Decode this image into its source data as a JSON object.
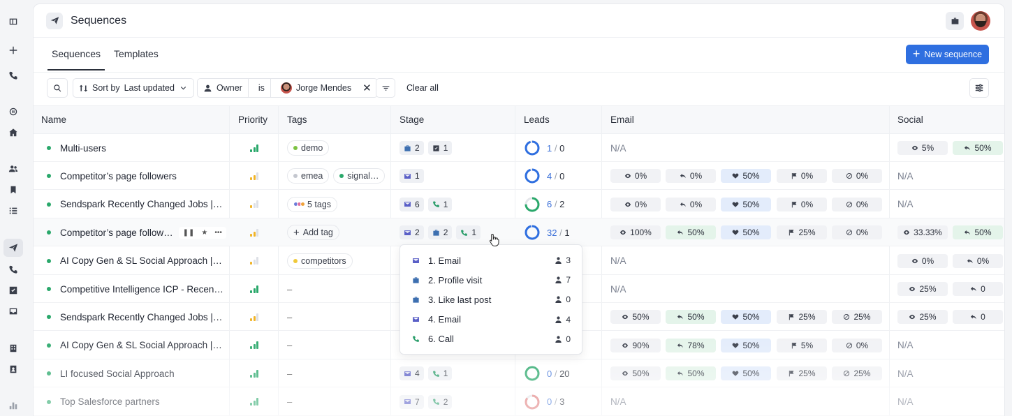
{
  "app": {
    "title": "Sequences"
  },
  "tabs": [
    {
      "label": "Sequences",
      "active": true
    },
    {
      "label": "Templates",
      "active": false
    }
  ],
  "new_button": {
    "label": "New sequence"
  },
  "filters": {
    "sort_prefix": "Sort by",
    "sort_value": "Last updated",
    "owner_label": "Owner",
    "operator": "is",
    "owner_value": "Jorge Mendes",
    "clear_all": "Clear all"
  },
  "columns": {
    "name": "Name",
    "priority": "Priority",
    "tags": "Tags",
    "stage": "Stage",
    "leads": "Leads",
    "email": "Email",
    "social": "Social"
  },
  "colors": {
    "accent": "#2f6fe0",
    "active_dot": "#2aa86b",
    "email_stage": "#5a5fc7",
    "linkedin_stage": "#3d6fb0",
    "call_stage": "#2a9d6a",
    "priority_high": "#2aa86b",
    "priority_mid": "#f0b429"
  },
  "rows": [
    {
      "name": "Multi-users",
      "priority": "high",
      "tags": [
        {
          "label": "demo",
          "color": "#7cc242"
        }
      ],
      "stage": [
        {
          "type": "linkedin",
          "count": "2"
        },
        {
          "type": "task",
          "count": "1"
        }
      ],
      "leads_a": "1",
      "leads_b": "0",
      "ring": 0.95,
      "ring_color": "#2f6fe0",
      "email_na": "N/A",
      "social": [
        "5%",
        "50%"
      ]
    },
    {
      "name": "Competitor’s page followers",
      "priority": "mid",
      "tags": [
        {
          "label": "emea",
          "color": "#c4c7cf"
        },
        {
          "label": "signal…",
          "color": "#2aa86b"
        }
      ],
      "stage": [
        {
          "type": "email",
          "count": "1"
        }
      ],
      "leads_a": "4",
      "leads_b": "0",
      "ring": 0.95,
      "ring_color": "#2f6fe0",
      "email": [
        "0%",
        "0%",
        "50%",
        "0%",
        "0%"
      ],
      "social_na": "N/A"
    },
    {
      "name": "Sendspark Recently Changed Jobs |…",
      "priority": "low",
      "tags": [
        {
          "label": "5 tags",
          "multi": true
        }
      ],
      "stage": [
        {
          "type": "email",
          "count": "6"
        },
        {
          "type": "call",
          "count": "1"
        }
      ],
      "leads_a": "6",
      "leads_b": "2",
      "ring": 0.75,
      "ring_color": "#2aa86b",
      "email": [
        "0%",
        "0%",
        "50%",
        "0%",
        "0%"
      ],
      "social_na": "N/A"
    },
    {
      "name": "Competitor’s page follow…",
      "priority": "mid",
      "hover": true,
      "add_tag": "Add tag",
      "stage": [
        {
          "type": "email",
          "count": "2"
        },
        {
          "type": "linkedin",
          "count": "2"
        },
        {
          "type": "call",
          "count": "1"
        }
      ],
      "leads_a": "32",
      "leads_b": "1",
      "ring": 0.97,
      "ring_color": "#2f6fe0",
      "email": [
        "100%",
        "50%",
        "50%",
        "25%",
        "0%"
      ],
      "social": [
        "33.33%",
        "50%"
      ]
    },
    {
      "name": "AI Copy Gen & SL Social Approach | S…",
      "priority": "low",
      "tags": [
        {
          "label": "competitors",
          "color": "#f0c93a"
        }
      ],
      "email_na": "N/A",
      "social": [
        "0%",
        "0%"
      ]
    },
    {
      "name": "Competitive Intelligence ICP - Recent…",
      "priority": "high",
      "tags_dash": "–",
      "email_na": "N/A",
      "social": [
        "25%",
        "0"
      ]
    },
    {
      "name": "Sendspark Recently Changed Jobs |…",
      "priority": "mid",
      "tags_dash": "–",
      "email": [
        "50%",
        "50%",
        "50%",
        "25%",
        "25%"
      ],
      "social": [
        "25%",
        "0"
      ]
    },
    {
      "name": "AI Copy Gen & SL Social Approach | S…",
      "priority": "high",
      "tags_dash": "–",
      "email": [
        "90%",
        "78%",
        "50%",
        "5%",
        "0%"
      ],
      "social_na": "N/A"
    },
    {
      "name": "LI focused Social Approach",
      "priority": "high",
      "tags_dash": "–",
      "stage": [
        {
          "type": "email",
          "count": "4"
        },
        {
          "type": "call",
          "count": "1"
        }
      ],
      "leads_a": "0",
      "leads_b": "20",
      "ring": 1.0,
      "ring_color": "#2aa86b",
      "email": [
        "50%",
        "50%",
        "50%",
        "25%",
        "25%"
      ],
      "social_na": "N/A"
    },
    {
      "name": "Top Salesforce partners",
      "priority": "high",
      "tags_dash": "–",
      "stage": [
        {
          "type": "email",
          "count": "7"
        },
        {
          "type": "call",
          "count": "2"
        }
      ],
      "leads_a": "0",
      "leads_b": "3",
      "ring": 0.85,
      "ring_color": "#e07b7b",
      "email_na": "N/A",
      "social_na": "N/A"
    }
  ],
  "popup": {
    "items": [
      {
        "label": "1. Email",
        "type": "email",
        "count": "3"
      },
      {
        "label": "2. Profile visit",
        "type": "linkedin",
        "count": "7"
      },
      {
        "label": "3. Like last post",
        "type": "linkedin",
        "count": "0"
      },
      {
        "label": "4. Email",
        "type": "email",
        "count": "4"
      },
      {
        "label": "6. Call",
        "type": "call",
        "count": "0"
      }
    ]
  }
}
